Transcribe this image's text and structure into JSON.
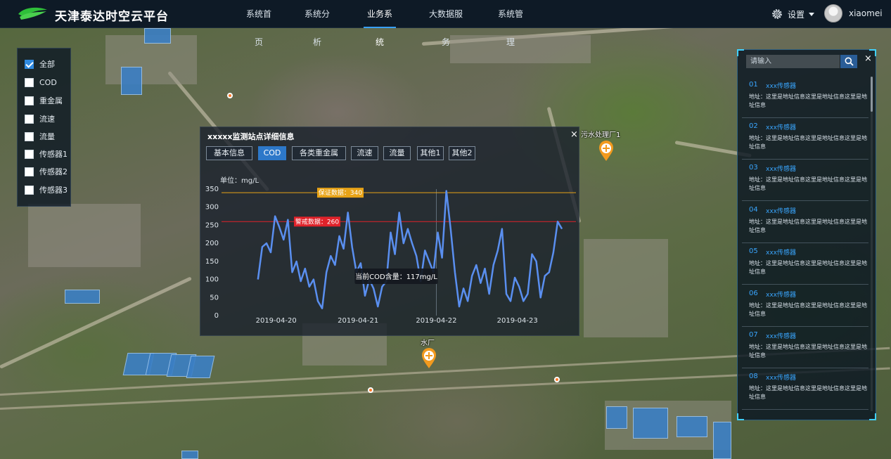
{
  "app": {
    "title": "天津泰达时空云平台"
  },
  "nav": {
    "items": [
      {
        "label": "系统首页",
        "active": false
      },
      {
        "label": "系统分析",
        "active": false
      },
      {
        "label": "业务系统",
        "active": true
      },
      {
        "label": "大数据服务",
        "active": false
      },
      {
        "label": "系统管理",
        "active": false
      }
    ],
    "settings_label": "设置",
    "username": "xiaomei"
  },
  "filters": {
    "items": [
      {
        "label": "全部",
        "checked": true
      },
      {
        "label": "COD",
        "checked": false
      },
      {
        "label": "重金属",
        "checked": false
      },
      {
        "label": "流速",
        "checked": false
      },
      {
        "label": "流量",
        "checked": false
      },
      {
        "label": "传感器1",
        "checked": false
      },
      {
        "label": "传感器2",
        "checked": false
      },
      {
        "label": "传感器3",
        "checked": false
      }
    ]
  },
  "detail": {
    "title": "xxxxx监测站点详细信息",
    "close_icon": "×",
    "tabs": [
      {
        "label": "基本信息",
        "active": false
      },
      {
        "label": "COD",
        "active": true
      },
      {
        "label": "各类重金属",
        "active": false
      },
      {
        "label": "流速",
        "active": false
      },
      {
        "label": "流量",
        "active": false
      },
      {
        "label": "其他1",
        "active": false
      },
      {
        "label": "其他2",
        "active": false
      }
    ],
    "unit_label": "单位：mg/L"
  },
  "chart_data": {
    "type": "line",
    "unit": "mg/L",
    "ylim": [
      0,
      350
    ],
    "yticks": [
      0,
      50,
      100,
      150,
      200,
      250,
      300,
      350
    ],
    "xticks": [
      {
        "label": "2019-04-20",
        "x": 2
      },
      {
        "label": "2019-04-21",
        "x": 11
      },
      {
        "label": "2019-04-22",
        "x": 19.6
      },
      {
        "label": "2019-04-23",
        "x": 28.5
      }
    ],
    "xlim": [
      -4,
      35.4
    ],
    "values": [
      100,
      190,
      200,
      175,
      275,
      245,
      210,
      265,
      120,
      150,
      95,
      130,
      80,
      100,
      40,
      20,
      120,
      165,
      140,
      220,
      185,
      285,
      190,
      120,
      145,
      55,
      100,
      75,
      25,
      80,
      95,
      230,
      170,
      285,
      200,
      240,
      200,
      165,
      95,
      180,
      150,
      120,
      230,
      160,
      345,
      240,
      120,
      25,
      75,
      40,
      110,
      140,
      90,
      130,
      60,
      140,
      180,
      240,
      60,
      40,
      105,
      80,
      40,
      60,
      170,
      150,
      50,
      110,
      120,
      175,
      260,
      240
    ],
    "reference_lines": [
      {
        "label": "保证数据：340",
        "value": 340,
        "color": "#e8a317"
      },
      {
        "label": "警戒数据：260",
        "value": 260,
        "color": "#e0222a"
      }
    ],
    "crosshair_x": 19.6,
    "tooltip": "当前COD含量：117mg/L",
    "series_color": "#5a8ff0"
  },
  "map": {
    "sites": [
      {
        "name": "污水处理厂1"
      },
      {
        "name": "污水处理厂"
      },
      {
        "name": "污水处理厂"
      },
      {
        "name": "水厂"
      }
    ]
  },
  "sensor_panel": {
    "search_placeholder": "请输入",
    "close_icon": "×",
    "items": [
      {
        "num": "01",
        "name": "xxx传感器",
        "addr": "地址：这里是地址信息这里是地址信息这里是地址信息"
      },
      {
        "num": "02",
        "name": "xxx传感器",
        "addr": "地址：这里是地址信息这里是地址信息这里是地址信息"
      },
      {
        "num": "03",
        "name": "xxx传感器",
        "addr": "地址：这里是地址信息这里是地址信息这里是地址信息"
      },
      {
        "num": "04",
        "name": "xxx传感器",
        "addr": "地址：这里是地址信息这里是地址信息这里是地址信息"
      },
      {
        "num": "05",
        "name": "xxx传感器",
        "addr": "地址：这里是地址信息这里是地址信息这里是地址信息"
      },
      {
        "num": "06",
        "name": "xxx传感器",
        "addr": "地址：这里是地址信息这里是地址信息这里是地址信息"
      },
      {
        "num": "07",
        "name": "xxx传感器",
        "addr": "地址：这里是地址信息这里是地址信息这里是地址信息"
      },
      {
        "num": "08",
        "name": "xxx传感器",
        "addr": "地址：这里是地址信息这里是地址信息这里是地址信息"
      }
    ]
  }
}
